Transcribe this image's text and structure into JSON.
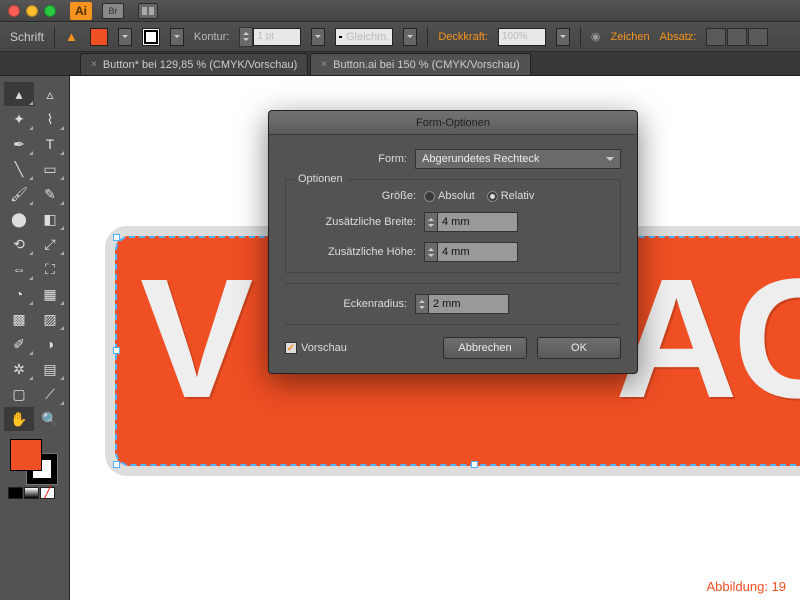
{
  "titlebar": {
    "ai": "Ai",
    "br": "Br"
  },
  "controlbar": {
    "left_label": "Schrift",
    "fill_color": "#f04e23",
    "stroke_label": "Kontur:",
    "stroke_weight": "1 pt",
    "stroke_style": "Gleichm.",
    "opacity_label": "Deckkraft:",
    "opacity_value": "100%",
    "panel_char": "Zeichen",
    "panel_para": "Absatz:"
  },
  "tabs": [
    {
      "label": "Button* bei 129,85 % (CMYK/Vorschau)"
    },
    {
      "label": "Button.ai bei 150 % (CMYK/Vorschau)"
    }
  ],
  "canvas": {
    "letter_v": "V",
    "letter_ag": "AG",
    "caption": "Abbildung: 19"
  },
  "dialog": {
    "title": "Form-Optionen",
    "shape_label": "Form:",
    "shape_value": "Abgerundetes Rechteck",
    "options_legend": "Optionen",
    "size_label": "Größe:",
    "size_abs": "Absolut",
    "size_rel": "Relativ",
    "extra_w_label": "Zusätzliche Breite:",
    "extra_w_value": "4 mm",
    "extra_h_label": "Zusätzliche Höhe:",
    "extra_h_value": "4 mm",
    "radius_label": "Eckenradius:",
    "radius_value": "2 mm",
    "preview_label": "Vorschau",
    "cancel": "Abbrechen",
    "ok": "OK"
  }
}
